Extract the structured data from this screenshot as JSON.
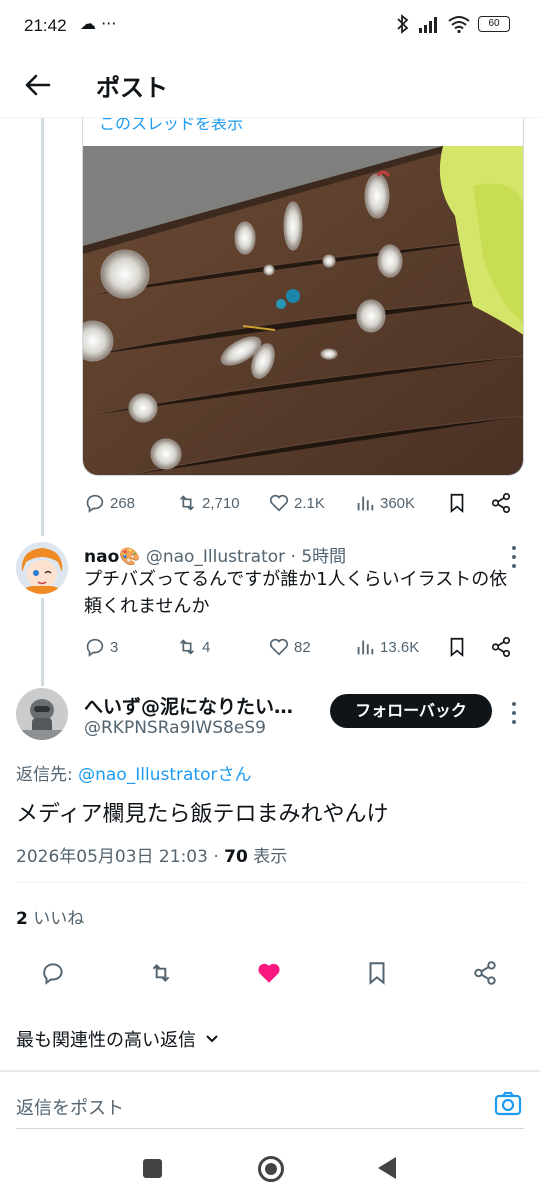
{
  "status_bar": {
    "time": "21:42",
    "left_icons": "☁ ···",
    "battery": "60"
  },
  "topbar": {
    "title": "ポスト"
  },
  "quoted_post": {
    "show_thread": "このスレッドを表示",
    "stats": {
      "replies": "268",
      "reposts": "2,710",
      "likes": "2.1K",
      "views": "360K"
    }
  },
  "reply": {
    "name": "nao🎨",
    "handle": "@nao_Illustrator",
    "time": "· 5時間",
    "text": "プチバズってるんですが誰か1人くらいイラストの依頼くれませんか",
    "stats": {
      "replies": "3",
      "reposts": "4",
      "likes": "82",
      "views": "13.6K"
    }
  },
  "main_post": {
    "name": "へいず@泥になりたい…",
    "handle": "@RKPNSRa9IWS8eS9",
    "follow_button": "フォローバック",
    "reply_to_prefix": "返信先: ",
    "reply_to_link": "@nao_Illustratorさん",
    "text": "メディア欄見たら飯テロまみれやんけ",
    "timestamp": "2026年05月03日 21:03 · ",
    "views_count": "70",
    "views_label": " 表示",
    "likes_count": "2",
    "likes_label": " いいね",
    "like_color": "#f91880"
  },
  "sort": {
    "label": "最も関連性の高い返信"
  },
  "compose": {
    "placeholder": "返信をポスト"
  },
  "colors": {
    "accent": "#1d9bf0",
    "text_secondary": "#536471"
  }
}
